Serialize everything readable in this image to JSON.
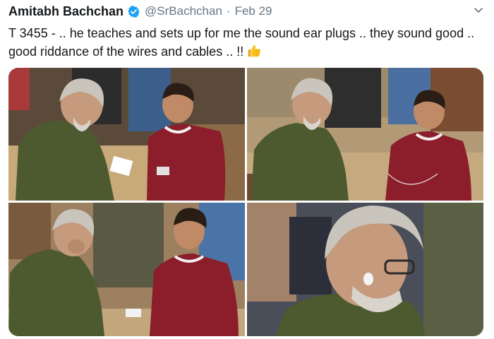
{
  "tweet": {
    "display_name": "Amitabh Bachchan",
    "handle": "@SrBachchan",
    "separator": "·",
    "date": "Feb 29",
    "text": "T 3455 - .. he teaches and sets up for me the sound ear plugs .. they sound good .. good riddance of the wires and cables .. !!",
    "emoji": "thumbs-up-icon"
  },
  "media": {
    "photos": [
      {
        "name": "photo-1"
      },
      {
        "name": "photo-2"
      },
      {
        "name": "photo-3"
      },
      {
        "name": "photo-4"
      }
    ]
  },
  "colors": {
    "verified": "#1da1f2",
    "secondary_text": "#657786",
    "jacket": "#4d5a2f",
    "sweater": "#8c1d2a"
  }
}
